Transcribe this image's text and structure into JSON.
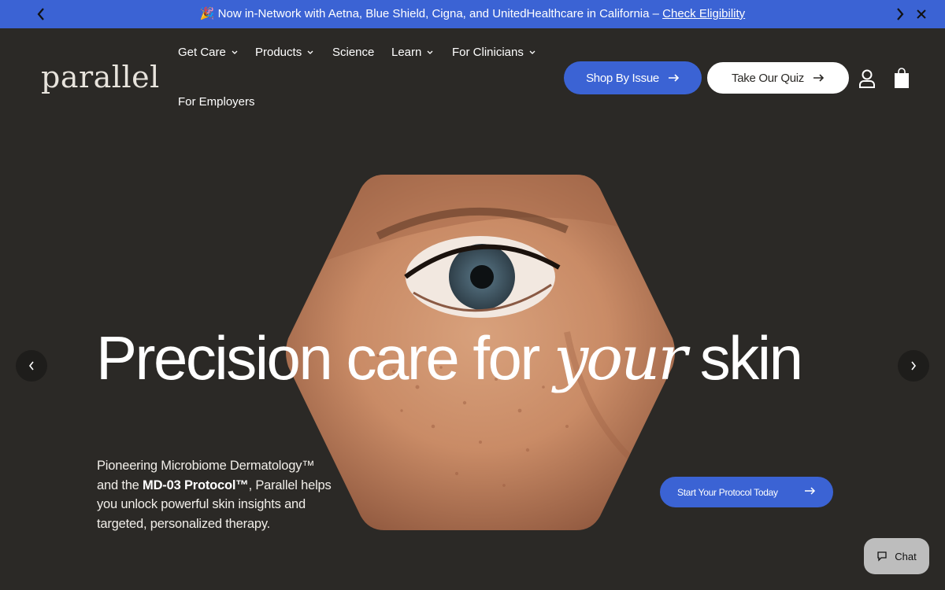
{
  "announcement": {
    "emoji": "🎉",
    "message": "Now in-Network with Aetna, Blue Shield, Cigna, and UnitedHealthcare in California –",
    "link_label": "Check Eligibility"
  },
  "header": {
    "logo": "parallel",
    "nav": [
      {
        "label": "Get Care",
        "dropdown": true
      },
      {
        "label": "Products",
        "dropdown": true
      },
      {
        "label": "Science",
        "dropdown": false
      },
      {
        "label": "Learn",
        "dropdown": true
      },
      {
        "label": "For Clinicians",
        "dropdown": true
      },
      {
        "label": "For Employers",
        "dropdown": false
      }
    ],
    "shop_button": "Shop By Issue",
    "quiz_button": "Take Our Quiz",
    "icons": [
      "user-icon",
      "shopping-bag-icon"
    ]
  },
  "hero": {
    "headline_start": "Precision care for",
    "headline_script": "your",
    "headline_end": "skin",
    "copy_part1": "Pioneering Microbiome Dermatology™ and the",
    "copy_bold": "MD-03 Protocol™",
    "copy_part2": ", Parallel helps you unlock powerful skin insights and targeted, personalized therapy.",
    "cta": "Start Your Protocol Today"
  },
  "chat": {
    "label": "Chat"
  },
  "colors": {
    "background": "#2b2926",
    "accent": "#3b63d4",
    "announcement_bg": "#3b63d4",
    "logo": "#e7e3dc"
  }
}
